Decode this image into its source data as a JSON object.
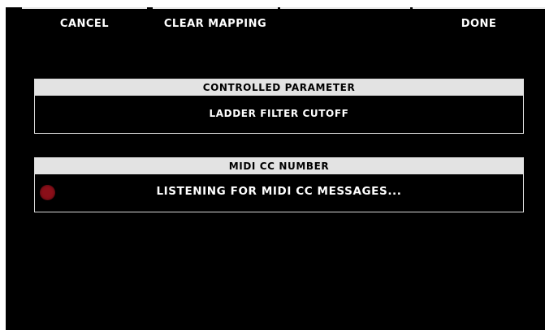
{
  "softkeys": [
    {
      "label": "CANCEL"
    },
    {
      "label": "CLEAR MAPPING"
    },
    {
      "label": ""
    },
    {
      "label": "DONE"
    }
  ],
  "controlled_parameter": {
    "header": "CONTROLLED PARAMETER",
    "value": "LADDER FILTER CUTOFF"
  },
  "midi_cc": {
    "header": "MIDI CC NUMBER",
    "status": "LISTENING FOR MIDI CC MESSAGES...",
    "led_color": "#8b0f19",
    "led_icon": "record-indicator-icon"
  },
  "colors": {
    "background": "#000000",
    "header_bg": "#e3e3e3",
    "border": "#d9d9d9"
  }
}
